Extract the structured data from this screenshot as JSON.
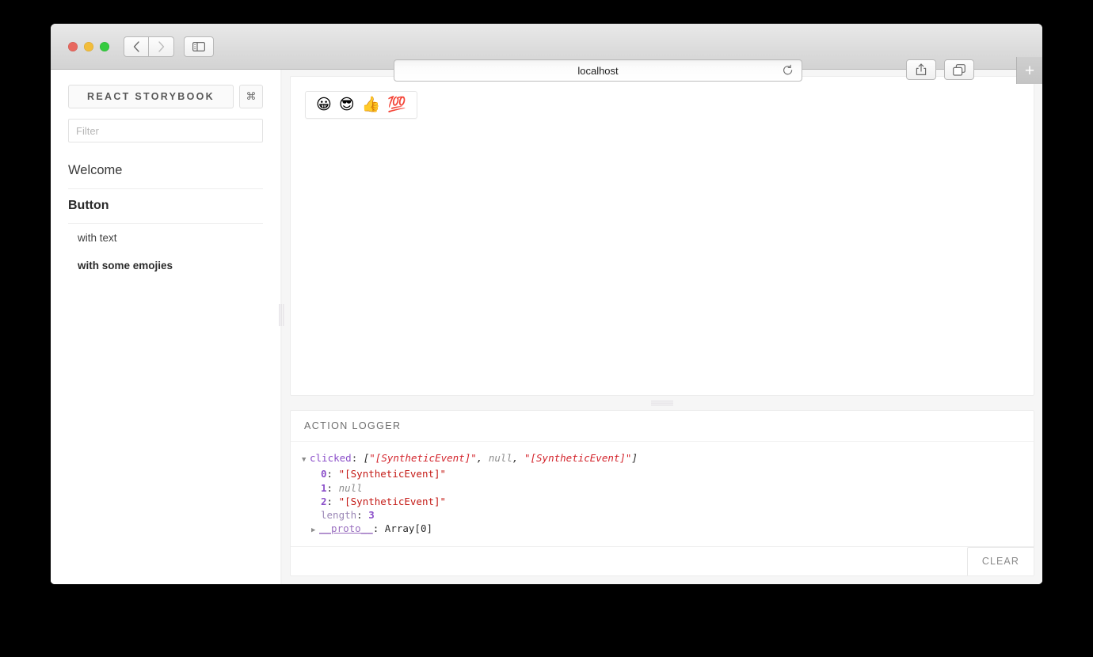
{
  "browser": {
    "url_text": "localhost",
    "back_label": "‹",
    "forward_label": "›",
    "newtab_label": "+",
    "icons": {
      "back": "chevron-left-icon",
      "forward": "chevron-right-icon",
      "sidebar": "sidebar-toggle-icon",
      "reload": "reload-icon",
      "share": "share-icon",
      "tabs": "tab-overview-icon",
      "newtab": "new-tab-icon"
    }
  },
  "sidebar": {
    "brand": "REACT STORYBOOK",
    "shortcut_label": "⌘",
    "filter_placeholder": "Filter",
    "tree": [
      {
        "type": "kind",
        "label": "Welcome",
        "bold": false,
        "selected": false
      },
      {
        "type": "kind",
        "label": "Button",
        "bold": true,
        "selected": false
      },
      {
        "type": "story",
        "label": "with text",
        "selected": false
      },
      {
        "type": "story",
        "label": "with some emojies",
        "selected": true
      }
    ]
  },
  "preview": {
    "button_emojis": [
      "😀",
      "😎",
      "👍",
      "💯"
    ],
    "button_aria": "emoji-button"
  },
  "logger": {
    "title": "ACTION LOGGER",
    "clear_label": "CLEAR",
    "entry": {
      "toggle": "▼",
      "action_name": "clicked",
      "colon": ": ",
      "summary_open": "[",
      "summary_close": "]",
      "summary_parts": [
        {
          "kind": "string",
          "text": "\"[SyntheticEvent]\""
        },
        {
          "kind": "sep",
          "text": ", "
        },
        {
          "kind": "null",
          "text": "null"
        },
        {
          "kind": "sep",
          "text": ", "
        },
        {
          "kind": "string",
          "text": "\"[SyntheticEvent]\""
        }
      ],
      "rows": [
        {
          "key": "0",
          "value": "\"[SyntheticEvent]\"",
          "value_kind": "string"
        },
        {
          "key": "1",
          "value": "null",
          "value_kind": "null"
        },
        {
          "key": "2",
          "value": "\"[SyntheticEvent]\"",
          "value_kind": "string"
        }
      ],
      "length_key": "length",
      "length_value": "3",
      "proto_toggle": "▶",
      "proto_key": "__proto__",
      "proto_value": "Array[0]"
    }
  },
  "colors": {
    "action_purple": "#8b4fc9",
    "string_red": "#c41a16",
    "null_gray": "#8d8d8d",
    "accent_border": "#ececec"
  }
}
